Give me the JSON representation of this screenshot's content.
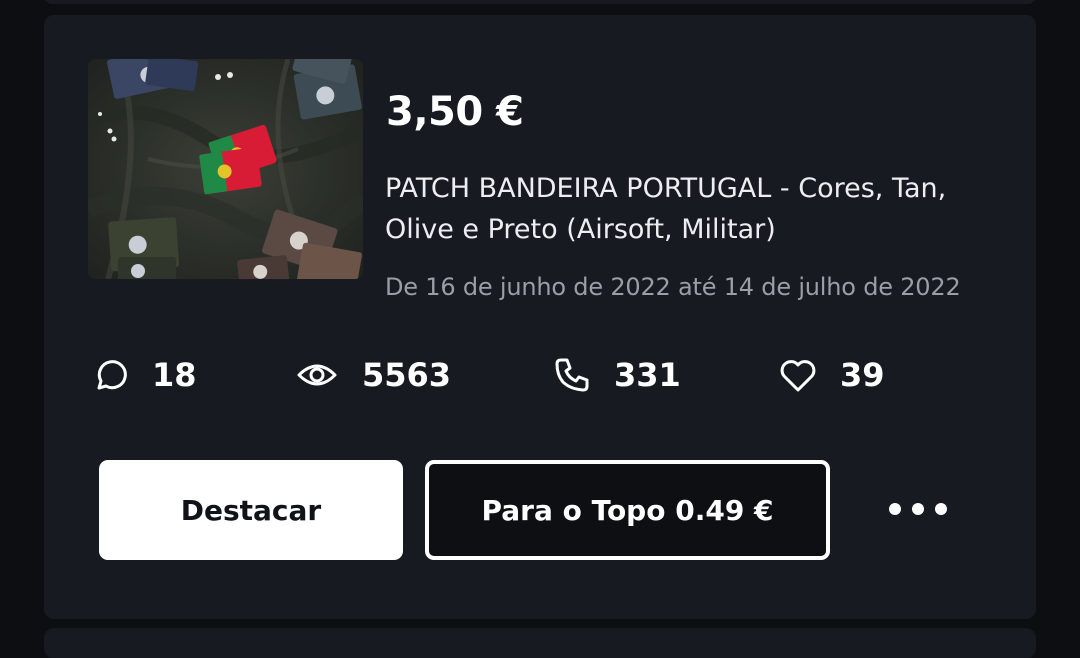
{
  "listing": {
    "price": "3,50 €",
    "title": "PATCH BANDEIRA PORTUGAL - Cores, Tan, Olive e Preto (Airsoft, Militar)",
    "date_range": "De 16 de junho de 2022 até 14 de julho de 2022",
    "image_subject": "Portuguese flag patches in several colors on dark fabric"
  },
  "stats": {
    "comments": "18",
    "views": "5563",
    "calls": "331",
    "likes": "39"
  },
  "actions": {
    "highlight_label": "Destacar",
    "to_top_label": "Para o Topo 0.49 €",
    "more_icon": "more-horizontal-icon"
  },
  "icons": {
    "comments": "chat-bubble-icon",
    "views": "eye-icon",
    "calls": "phone-icon",
    "likes": "heart-icon"
  },
  "colors": {
    "background": "#0c0e12",
    "card": "#171a21",
    "text_primary": "#ffffff",
    "text_secondary": "#9a9ea8"
  }
}
